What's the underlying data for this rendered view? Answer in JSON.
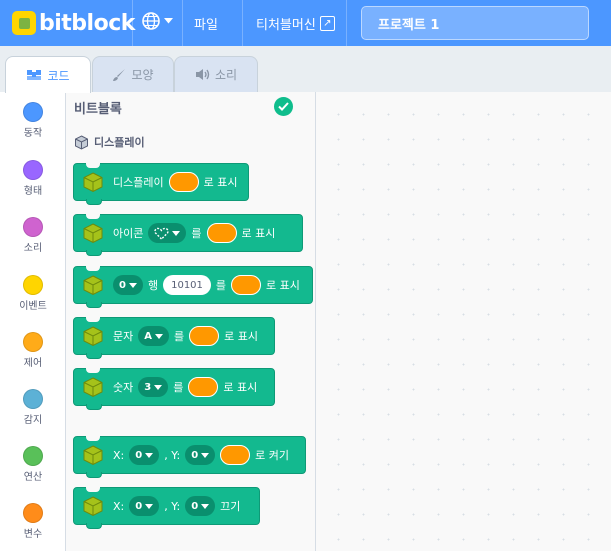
{
  "topbar": {
    "logo": "bitblock",
    "menu_file": "파일",
    "menu_teacher": "티처블머신",
    "project_title": "프로젝트 1"
  },
  "tabs": [
    {
      "label": "코드"
    },
    {
      "label": "모양"
    },
    {
      "label": "소리"
    }
  ],
  "categories": [
    {
      "label": "동작",
      "color": "#4c97ff"
    },
    {
      "label": "형태",
      "color": "#9966ff"
    },
    {
      "label": "소리",
      "color": "#cf63cf"
    },
    {
      "label": "이벤트",
      "color": "#ffd500"
    },
    {
      "label": "제어",
      "color": "#ffab19"
    },
    {
      "label": "감지",
      "color": "#5cb1d6"
    },
    {
      "label": "연산",
      "color": "#59c059"
    },
    {
      "label": "변수",
      "color": "#ff8c1a"
    }
  ],
  "palette": {
    "title": "비트블록",
    "section": "디스플레이",
    "blocks": {
      "b1": {
        "t1": "디스플레이",
        "t2": "로 표시"
      },
      "b2": {
        "t1": "아이콘",
        "t2": "를",
        "t3": "로 표시"
      },
      "b3": {
        "dd1": "0",
        "t1": "행",
        "num": "10101",
        "t2": "를",
        "t3": "로 표시"
      },
      "b4": {
        "t1": "문자",
        "dd1": "A",
        "t2": "를",
        "t3": "로 표시"
      },
      "b5": {
        "t1": "숫자",
        "dd1": "3",
        "t2": "를",
        "t3": "로 표시"
      },
      "b6": {
        "t1": "X:",
        "dd1": "0",
        "t2": ", Y:",
        "dd2": "0",
        "t3": "로 켜기"
      },
      "b7": {
        "t1": "X:",
        "dd1": "0",
        "t2": ", Y:",
        "dd2": "0",
        "t3": "끄기"
      }
    }
  },
  "colors": {
    "accent": "#4c97ff",
    "block": "#13b98f",
    "input_color": "#ff9800"
  }
}
